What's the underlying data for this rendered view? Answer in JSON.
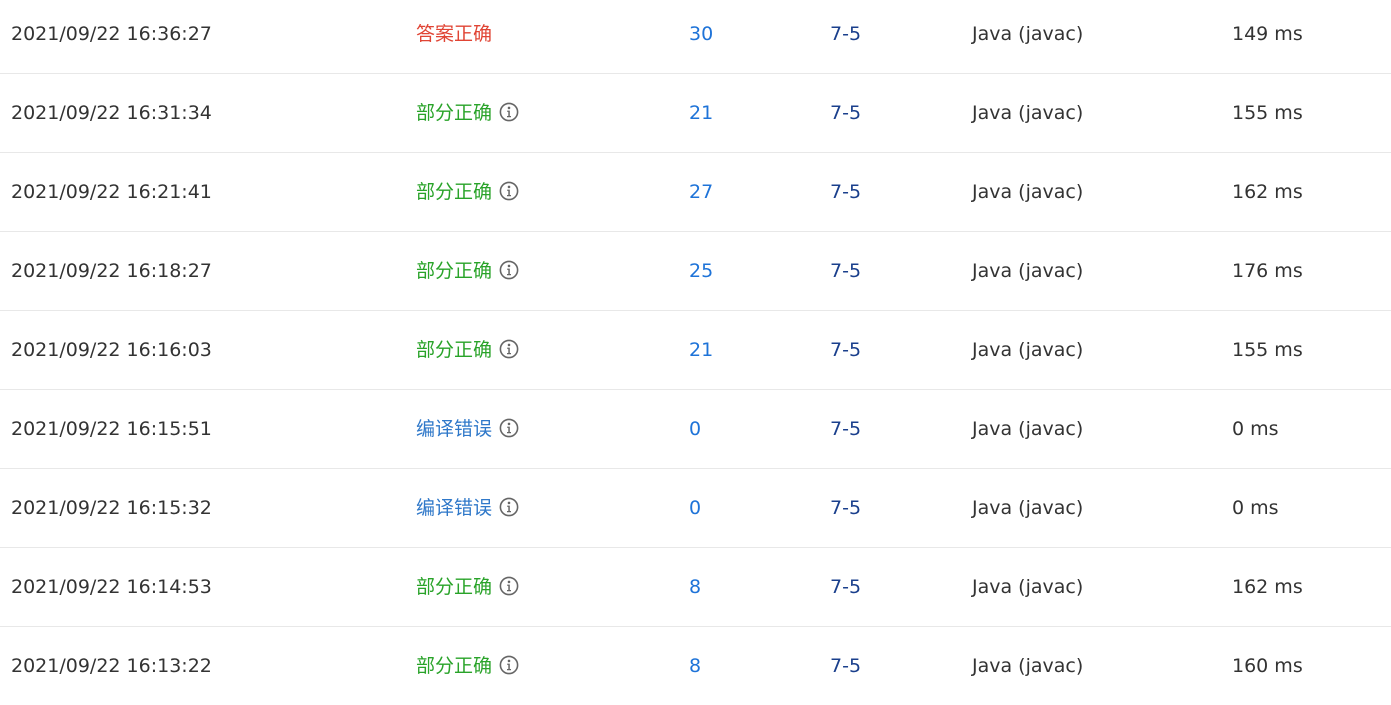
{
  "colors": {
    "accepted": "#e04434",
    "partial": "#29a329",
    "compile_error": "#2f78c9",
    "score_link": "#1e73d8",
    "problem_link": "#1a3f8c",
    "info_icon": "#666666",
    "row_divider": "#e8e8e8"
  },
  "submissions": [
    {
      "time": "2021/09/22 16:36:27",
      "status": "答案正确",
      "status_type": "accepted",
      "info_icon": false,
      "score": "30",
      "problem": "7-5",
      "language": "Java (javac)",
      "time_used": "149 ms"
    },
    {
      "time": "2021/09/22 16:31:34",
      "status": "部分正确",
      "status_type": "partial",
      "info_icon": true,
      "score": "21",
      "problem": "7-5",
      "language": "Java (javac)",
      "time_used": "155 ms"
    },
    {
      "time": "2021/09/22 16:21:41",
      "status": "部分正确",
      "status_type": "partial",
      "info_icon": true,
      "score": "27",
      "problem": "7-5",
      "language": "Java (javac)",
      "time_used": "162 ms"
    },
    {
      "time": "2021/09/22 16:18:27",
      "status": "部分正确",
      "status_type": "partial",
      "info_icon": true,
      "score": "25",
      "problem": "7-5",
      "language": "Java (javac)",
      "time_used": "176 ms"
    },
    {
      "time": "2021/09/22 16:16:03",
      "status": "部分正确",
      "status_type": "partial",
      "info_icon": true,
      "score": "21",
      "problem": "7-5",
      "language": "Java (javac)",
      "time_used": "155 ms"
    },
    {
      "time": "2021/09/22 16:15:51",
      "status": "编译错误",
      "status_type": "compile_error",
      "info_icon": true,
      "score": "0",
      "problem": "7-5",
      "language": "Java (javac)",
      "time_used": "0 ms"
    },
    {
      "time": "2021/09/22 16:15:32",
      "status": "编译错误",
      "status_type": "compile_error",
      "info_icon": true,
      "score": "0",
      "problem": "7-5",
      "language": "Java (javac)",
      "time_used": "0 ms"
    },
    {
      "time": "2021/09/22 16:14:53",
      "status": "部分正确",
      "status_type": "partial",
      "info_icon": true,
      "score": "8",
      "problem": "7-5",
      "language": "Java (javac)",
      "time_used": "162 ms"
    },
    {
      "time": "2021/09/22 16:13:22",
      "status": "部分正确",
      "status_type": "partial",
      "info_icon": true,
      "score": "8",
      "problem": "7-5",
      "language": "Java (javac)",
      "time_used": "160 ms"
    }
  ]
}
